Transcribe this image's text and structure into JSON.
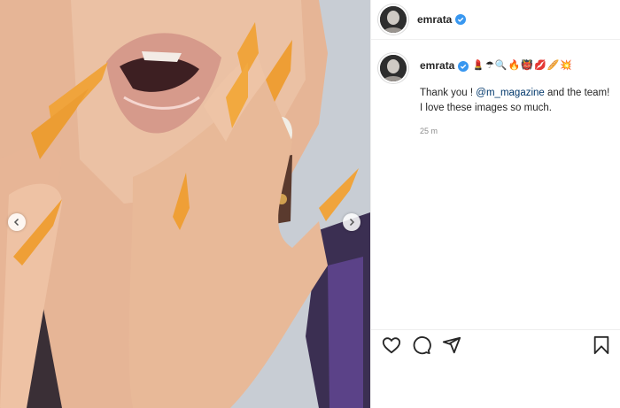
{
  "post": {
    "username": "emrata",
    "caption_emojis": "💄☂🔍🔥👹💋🥖💥",
    "caption_before": "Thank you ! ",
    "caption_mention": "@m_magazine",
    "caption_after": " and the team! I love these images so much.",
    "time": "25 m",
    "verified": true
  },
  "photo": {
    "description_alt": "Close-up of lips and hands with long orange nails"
  },
  "colors": {
    "nail": "#f0a43c",
    "skin": "#e9b99a",
    "verified": "#3897f0",
    "link": "#00376b"
  },
  "icons": [
    "heart-icon",
    "comment-icon",
    "share-icon",
    "bookmark-icon",
    "chevron-left-icon",
    "chevron-right-icon",
    "verified-icon"
  ]
}
